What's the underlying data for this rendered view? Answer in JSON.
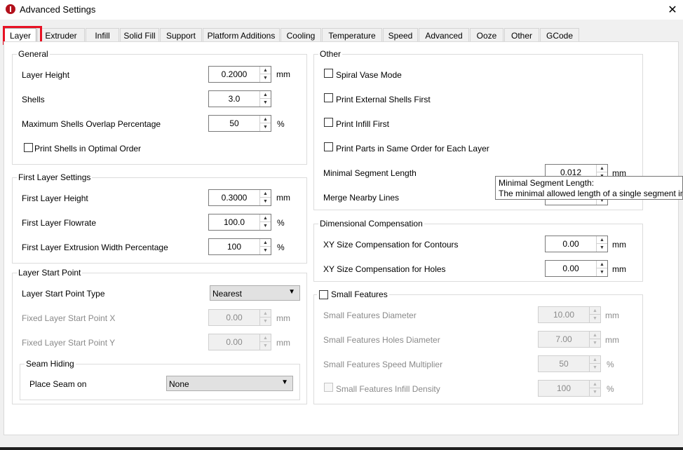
{
  "window": {
    "title": "Advanced Settings"
  },
  "tabs": [
    "Layer",
    "Extruder",
    "Infill",
    "Solid Fill",
    "Support",
    "Platform Additions",
    "Cooling",
    "Temperature",
    "Speed",
    "Advanced",
    "Ooze",
    "Other",
    "GCode"
  ],
  "general": {
    "title": "General",
    "layer_height": {
      "label": "Layer Height",
      "value": "0.2000",
      "unit": "mm"
    },
    "shells": {
      "label": "Shells",
      "value": "3.0"
    },
    "max_overlap": {
      "label": "Maximum Shells Overlap Percentage",
      "value": "50",
      "unit": "%"
    },
    "optimal_order": {
      "label": "Print Shells in Optimal Order",
      "checked": false
    }
  },
  "first_layer": {
    "title": "First Layer Settings",
    "height": {
      "label": "First Layer Height",
      "value": "0.3000",
      "unit": "mm"
    },
    "flowrate": {
      "label": "First Layer Flowrate",
      "value": "100.0",
      "unit": "%"
    },
    "width": {
      "label": "First Layer Extrusion Width Percentage",
      "value": "100",
      "unit": "%"
    }
  },
  "start_point": {
    "title": "Layer Start Point",
    "type": {
      "label": "Layer Start Point Type",
      "value": "Nearest"
    },
    "x": {
      "label": "Fixed Layer Start Point X",
      "value": "0.00",
      "unit": "mm"
    },
    "y": {
      "label": "Fixed Layer Start Point Y",
      "value": "0.00",
      "unit": "mm"
    },
    "seam": {
      "title": "Seam Hiding",
      "label": "Place Seam on",
      "value": "None"
    }
  },
  "other": {
    "title": "Other",
    "spiral": {
      "label": "Spiral Vase Mode",
      "checked": false
    },
    "external_first": {
      "label": "Print External Shells First",
      "checked": false
    },
    "infill_first": {
      "label": "Print Infill First",
      "checked": false
    },
    "same_order": {
      "label": "Print Parts in Same Order for Each Layer",
      "checked": false
    },
    "min_segment": {
      "label": "Minimal Segment Length",
      "value": "0.012",
      "unit": "mm"
    },
    "merge": {
      "label": "Merge Nearby Lines"
    }
  },
  "tooltip": {
    "title": "Minimal Segment Length:",
    "text": "The minimal allowed length of a single segment in"
  },
  "dimensional": {
    "title": "Dimensional Compensation",
    "contours": {
      "label": "XY Size Compensation for Contours",
      "value": "0.00",
      "unit": "mm"
    },
    "holes": {
      "label": "XY Size Compensation for Holes",
      "value": "0.00",
      "unit": "mm"
    }
  },
  "small_features": {
    "title": "Small Features",
    "checked": false,
    "diameter": {
      "label": "Small Features Diameter",
      "value": "10.00",
      "unit": "mm"
    },
    "holes_diameter": {
      "label": "Small Features Holes Diameter",
      "value": "7.00",
      "unit": "mm"
    },
    "speed": {
      "label": "Small Features Speed Multiplier",
      "value": "50",
      "unit": "%"
    },
    "infill": {
      "label": "Small Features Infill Density",
      "value": "100",
      "unit": "%"
    }
  },
  "icons": {
    "up": "▲",
    "down": "▼",
    "combo_arrow": "▼",
    "close": "✕"
  }
}
